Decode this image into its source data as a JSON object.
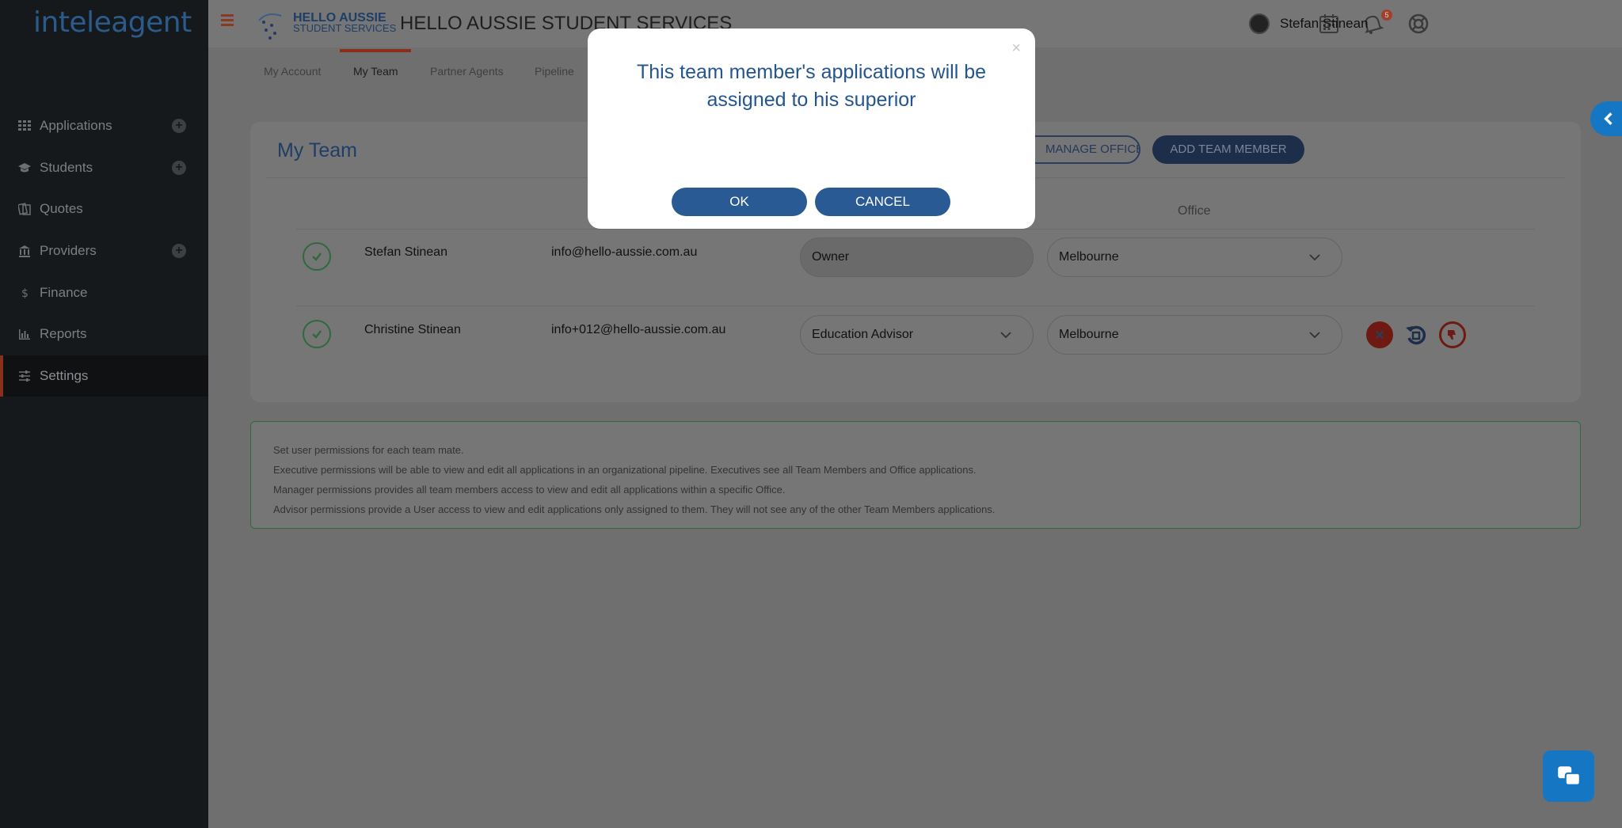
{
  "sidebar": {
    "logo": "inteleagent",
    "items": [
      {
        "label": "Applications",
        "icon": "grid-icon",
        "has_add": true
      },
      {
        "label": "Students",
        "icon": "graduation-cap-icon",
        "has_add": true
      },
      {
        "label": "Quotes",
        "icon": "quotes-icon",
        "has_add": false
      },
      {
        "label": "Providers",
        "icon": "bank-icon",
        "has_add": true
      },
      {
        "label": "Finance",
        "icon": "dollar-icon",
        "has_add": false
      },
      {
        "label": "Reports",
        "icon": "bar-chart-icon",
        "has_add": false
      },
      {
        "label": "Settings",
        "icon": "sliders-icon",
        "has_add": false,
        "active": true
      }
    ]
  },
  "header": {
    "brand_line1": "HELLO AUSSIE",
    "brand_line2": "STUDENT SERVICES",
    "company_name": "HELLO AUSSIE STUDENT SERVICES",
    "notification_count": "5",
    "user_name": "Stefan Stinean"
  },
  "tabs": [
    {
      "label": "My Account"
    },
    {
      "label": "My Team",
      "active": true
    },
    {
      "label": "Partner Agents"
    },
    {
      "label": "Pipeline"
    }
  ],
  "team": {
    "title": "My Team",
    "manage_offices_label": "MANAGE OFFICES",
    "add_member_label": "ADD TEAM MEMBER",
    "office_column": "Office",
    "members": [
      {
        "name": "Stefan Stinean",
        "email": "info@hello-aussie.com.au",
        "role": "Owner",
        "office": "Melbourne"
      },
      {
        "name": "Christine Stinean",
        "email": "info+012@hello-aussie.com.au",
        "role": "Education Advisor",
        "office": "Melbourne"
      }
    ]
  },
  "info": {
    "lines": [
      "Set user permissions for each team mate.",
      "Executive permissions will be able to view and edit all applications in an organizational pipeline. Executives see all Team Members and Office applications.",
      "Manager permissions provides all team members access to view and edit all applications within a specific Office.",
      "Advisor permissions provide a User access to view and edit applications only assigned to them. They will not see any of the other Team Members applications."
    ]
  },
  "modal": {
    "close_symbol": "×",
    "message": "This team member's applications will be assigned to his superior",
    "ok_label": "OK",
    "cancel_label": "CANCEL"
  },
  "colors": {
    "accent": "#2a5a93",
    "sidebar_bg": "#16191c",
    "active_indicator": "#8a2f1c",
    "chat_blue": "#1576c4"
  }
}
